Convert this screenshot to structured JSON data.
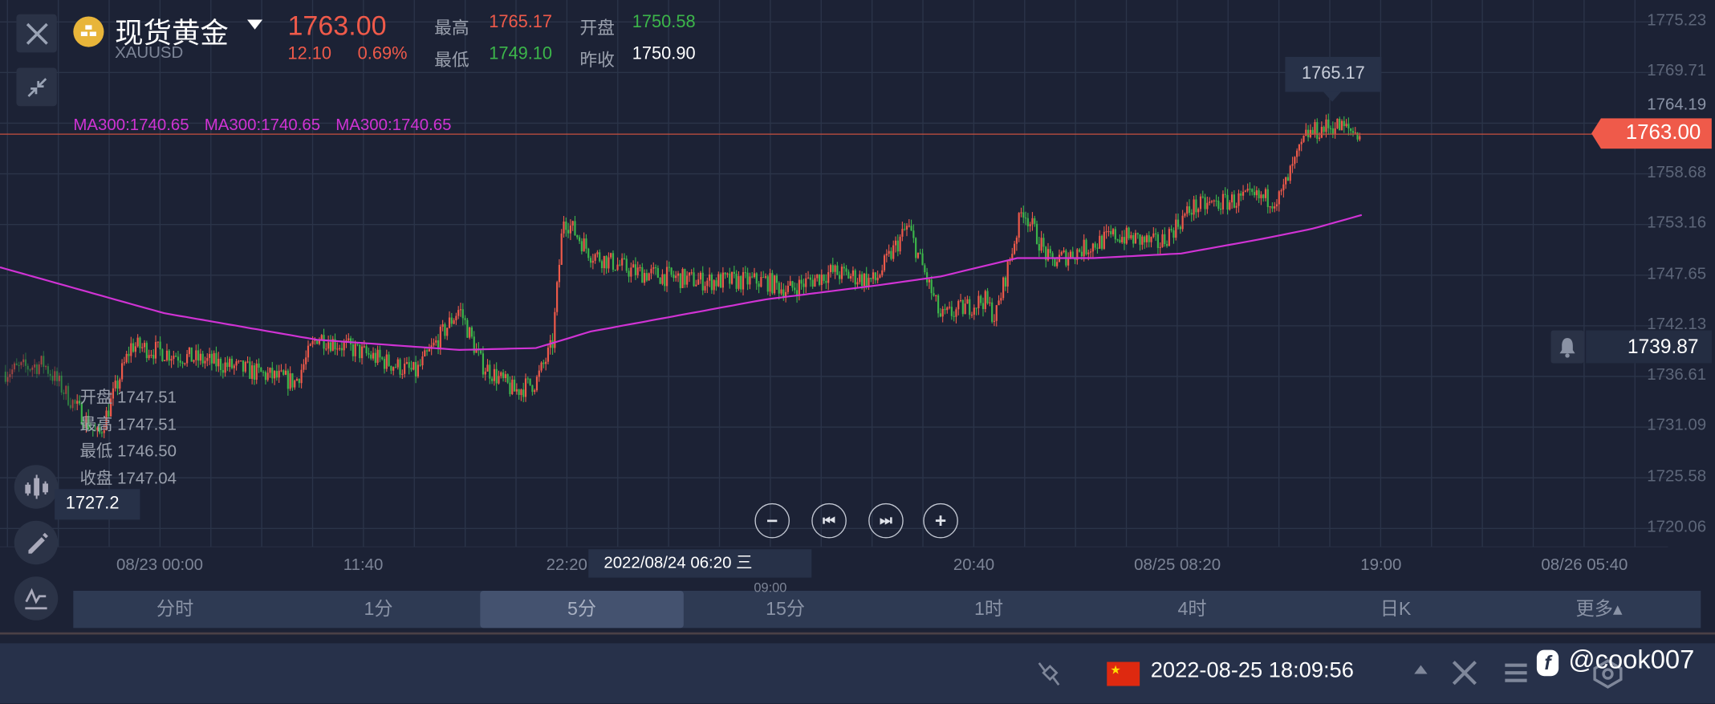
{
  "header": {
    "title": "现货黄金",
    "symbol": "XAUUSD",
    "price": "1763.00",
    "change": "12.10",
    "change_pct": "0.69%",
    "high_label": "最高",
    "high": "1765.17",
    "low_label": "最低",
    "low": "1749.10",
    "open_label": "开盘",
    "open": "1750.58",
    "prev_close_label": "昨收",
    "prev_close": "1750.90"
  },
  "ma_legend": [
    "MA300:1740.65",
    "MA300:1740.65",
    "MA300:1740.65"
  ],
  "y_axis": [
    "1775.23",
    "1769.71",
    "1764.19",
    "1758.68",
    "1753.16",
    "1747.65",
    "1742.13",
    "1736.61",
    "1731.09",
    "1725.58",
    "1720.06"
  ],
  "x_axis": [
    "08/23 00:00",
    "11:40",
    "22:20",
    "09:00",
    "20:40",
    "08/25 08:20",
    "19:00",
    "08/26 05:40"
  ],
  "current_price_tag": "1763.00",
  "high_tooltip": "1765.17",
  "alert_price": "1739.87",
  "crosshair": {
    "price": "1727.2",
    "date": "2022/08/24 06:20 三",
    "ohlc": [
      {
        "label": "开盘",
        "value": "1747.51"
      },
      {
        "label": "最高",
        "value": "1747.51"
      },
      {
        "label": "最低",
        "value": "1746.50"
      },
      {
        "label": "收盘",
        "value": "1747.04"
      }
    ]
  },
  "zoom_controls": {
    "zoom_out": "−",
    "prev": "⏮",
    "next": "⏭",
    "zoom_in": "+"
  },
  "tabs": [
    {
      "label": "分时"
    },
    {
      "label": "1分"
    },
    {
      "label": "5分",
      "active": true
    },
    {
      "label": "15分"
    },
    {
      "label": "1时"
    },
    {
      "label": "4时"
    },
    {
      "label": "日K"
    },
    {
      "label": "更多▴"
    }
  ],
  "status_bar": {
    "datetime": "2022-08-25 18:09:56",
    "watermark": "@cook007"
  },
  "colors": {
    "up": "#ef5a4a",
    "down": "#3cb64a",
    "ma": "#d033d4",
    "background": "#1c2235",
    "gold": "#e8b53a"
  }
}
